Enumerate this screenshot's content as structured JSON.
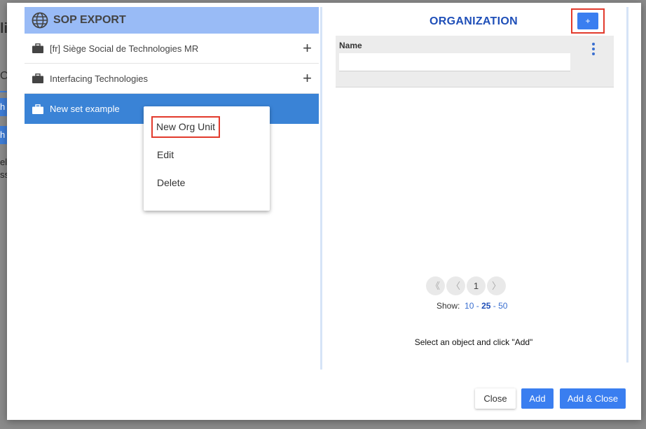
{
  "background": {
    "fragment_1": "li",
    "fragment_2": "C",
    "bar_1": "h",
    "bar_2": "h",
    "fragment_3": "el",
    "fragment_4": "ss"
  },
  "tree": {
    "title": "SOP EXPORT",
    "items": [
      {
        "label": "[fr] Siège Social de Technologies MR",
        "icon": "briefcase-icon",
        "has_add": true
      },
      {
        "label": "Interfacing Technologies",
        "icon": "briefcase-icon",
        "has_add": true
      },
      {
        "label": "New set example",
        "icon": "briefcase-icon",
        "selected": true
      }
    ]
  },
  "context_menu": {
    "items": [
      "New Org Unit",
      "Edit",
      "Delete"
    ]
  },
  "organization": {
    "title": "ORGANIZATION",
    "add_label": "+",
    "filter_label": "Name",
    "filter_value": "",
    "pager": {
      "first": "《",
      "prev": "〈",
      "page": "1",
      "next": "〉"
    },
    "show_label": "Show:",
    "show_options": [
      "10",
      "25",
      "50"
    ],
    "show_selected": "25",
    "hint": "Select an object and click \"Add\""
  },
  "footer": {
    "close_label": "Close",
    "add_label": "Add",
    "add_close_label": "Add & Close"
  },
  "colors": {
    "accent": "#3a7ef0",
    "selected_row": "#3a83d6",
    "header_bg": "#99bbf6",
    "title_blue": "#1f4fb8",
    "highlight_red": "#e23a2c"
  }
}
